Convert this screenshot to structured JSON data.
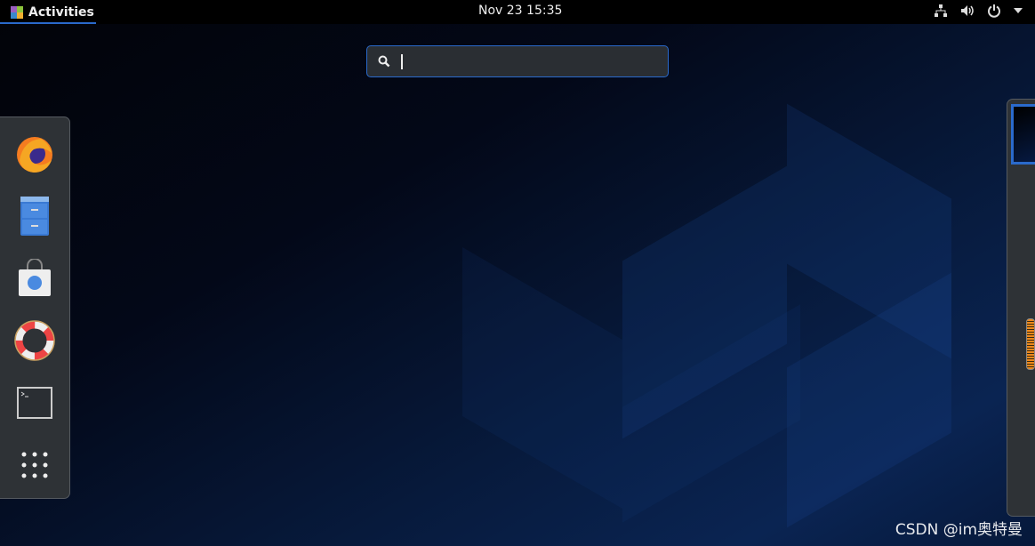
{
  "topbar": {
    "activities_label": "Activities",
    "clock": "Nov 23  15:35",
    "icons": [
      "network-icon",
      "volume-icon",
      "power-icon",
      "dropdown-arrow-icon"
    ]
  },
  "search": {
    "value": "",
    "placeholder": ""
  },
  "dash": {
    "apps": [
      {
        "name": "Firefox",
        "icon": "firefox-icon"
      },
      {
        "name": "Files",
        "icon": "file-cabinet-icon"
      },
      {
        "name": "Software",
        "icon": "shopping-bag-icon"
      },
      {
        "name": "Help",
        "icon": "lifebuoy-icon"
      },
      {
        "name": "Terminal",
        "icon": "terminal-icon"
      },
      {
        "name": "Show Applications",
        "icon": "app-grid-icon"
      }
    ]
  },
  "watermark": "CSDN @im奥特曼",
  "colors": {
    "accent": "#2a6acc",
    "panel": "#2e3236",
    "topbar": "#000000"
  }
}
